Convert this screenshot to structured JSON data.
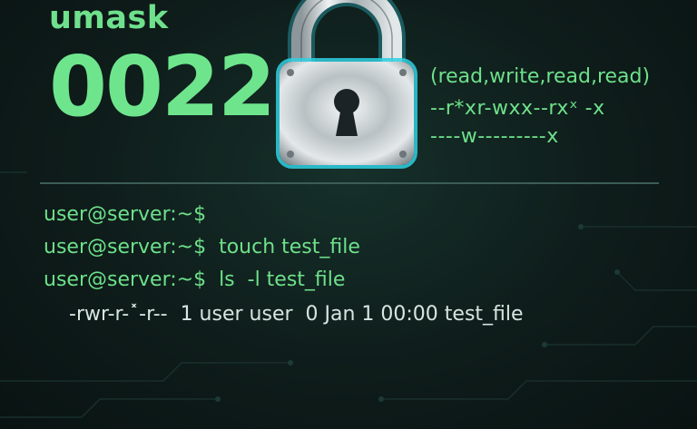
{
  "heading": "umask",
  "umask_value": "0022",
  "permissions": {
    "legend": "(read,write,read,read)",
    "line1": "--r*xr-wxx--rxˣ -x",
    "line2": "----w---------x"
  },
  "terminal": {
    "line1": "user@server:~$",
    "line2": "user@server:~$  touch test_file",
    "line3": "user@server:~$  ls  -l test_file",
    "output": "-rwr-r-˟-r--  1 user user  0 Jan 1 00:00 test_file"
  },
  "icons": [
    "padlock-icon"
  ],
  "colors": {
    "accent": "#6ee08a",
    "background": "#0e1c1a",
    "output_text": "#d8e6e0"
  }
}
